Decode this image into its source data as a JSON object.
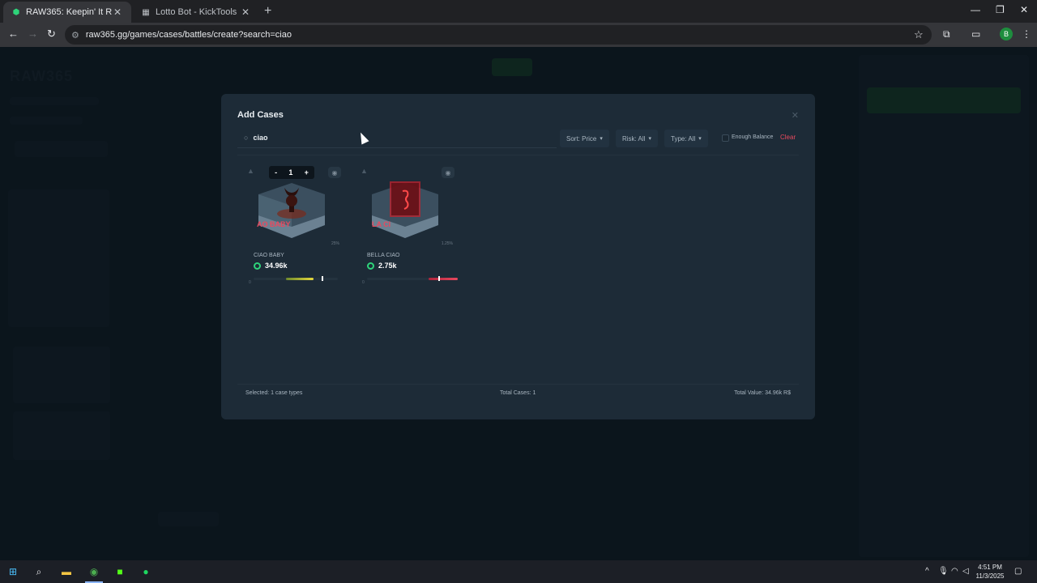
{
  "browser": {
    "tabs": [
      {
        "title": "RAW365: Keepin' It Raw",
        "active": true
      },
      {
        "title": "Lotto Bot - KickTools",
        "active": false
      }
    ],
    "url": "raw365.gg/games/cases/battles/create?search=ciao",
    "profile_initial": "B"
  },
  "modal": {
    "title": "Add Cases",
    "search_value": "ciao",
    "filters": {
      "sort": "Sort: Price",
      "risk": "Risk: All",
      "type": "Type: All"
    },
    "enough_balance_label": "Enough Balance",
    "clear_label": "Clear",
    "cards": [
      {
        "name": "CIAO BABY",
        "price": "34.96k",
        "quantity": "1",
        "percent": "25%",
        "bar_zero": "0",
        "box_label": "AO BABY"
      },
      {
        "name": "BELLA CIAO",
        "price": "2.75k",
        "percent": "1.25%",
        "bar_zero": "0",
        "box_label": "LA CI"
      }
    ],
    "stepper": {
      "minus": "-",
      "plus": "+"
    },
    "footer": {
      "selected": "Selected: 1 case types",
      "total_cases": "Total Cases: 1",
      "total_value": "Total Value: 34.96k R$"
    }
  },
  "taskbar": {
    "time": "4:51 PM",
    "date": "11/3/2025"
  },
  "colors": {
    "accent_green": "#2ed47a",
    "clear_red": "#e8495e",
    "modal_bg": "#1d2b37"
  }
}
